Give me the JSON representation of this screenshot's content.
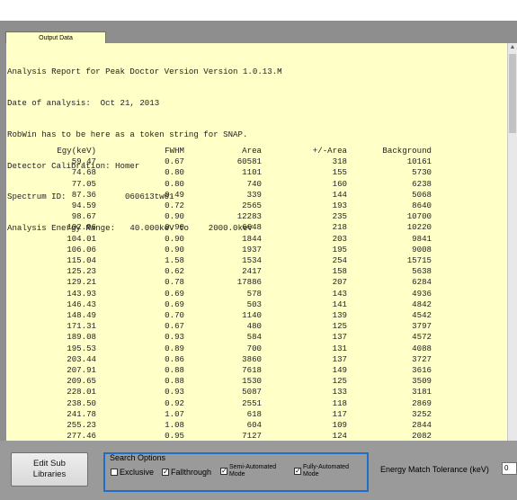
{
  "output_tab": {
    "label": "Output Data"
  },
  "report": {
    "lines": [
      "Analysis Report for Peak Doctor Version Version 1.0.13.M",
      "Date of analysis:  Oct 21, 2013",
      "RobWin has to be here as a token string for SNAP.",
      "Detector Calibration: Homer",
      "Spectrum ID:            060613tw01",
      "Analysis Energy Range:   40.000keV to    2000.0keV"
    ]
  },
  "peak_table": {
    "headers": [
      "Egy(keV)",
      "FWHM",
      "Area",
      "+/-Area",
      "Background"
    ],
    "rows": [
      [
        "59.47",
        "0.67",
        "60581",
        "318",
        "10161"
      ],
      [
        "74.68",
        "0.80",
        "1101",
        "155",
        "5730"
      ],
      [
        "77.05",
        "0.80",
        "740",
        "160",
        "6238"
      ],
      [
        "87.36",
        "0.49",
        "339",
        "144",
        "5068"
      ],
      [
        "94.59",
        "0.72",
        "2565",
        "193",
        "8640"
      ],
      [
        "98.67",
        "0.90",
        "12283",
        "235",
        "10700"
      ],
      [
        "102.96",
        "0.90",
        "6648",
        "218",
        "10220"
      ],
      [
        "104.01",
        "0.90",
        "1844",
        "203",
        "9841"
      ],
      [
        "106.06",
        "0.90",
        "1937",
        "195",
        "9008"
      ],
      [
        "115.04",
        "1.58",
        "1534",
        "254",
        "15715"
      ],
      [
        "125.23",
        "0.62",
        "2417",
        "158",
        "5638"
      ],
      [
        "129.21",
        "0.78",
        "17886",
        "207",
        "6284"
      ],
      [
        "143.93",
        "0.69",
        "578",
        "143",
        "4936"
      ],
      [
        "146.43",
        "0.69",
        "503",
        "141",
        "4842"
      ],
      [
        "148.49",
        "0.70",
        "1140",
        "139",
        "4542"
      ],
      [
        "171.31",
        "0.67",
        "480",
        "125",
        "3797"
      ],
      [
        "189.08",
        "0.93",
        "584",
        "137",
        "4572"
      ],
      [
        "195.53",
        "0.89",
        "700",
        "131",
        "4088"
      ],
      [
        "203.44",
        "0.86",
        "3860",
        "137",
        "3727"
      ],
      [
        "207.91",
        "0.88",
        "7618",
        "149",
        "3616"
      ],
      [
        "209.65",
        "0.88",
        "1530",
        "125",
        "3509"
      ],
      [
        "228.01",
        "0.93",
        "5087",
        "133",
        "3181"
      ],
      [
        "238.50",
        "0.92",
        "2551",
        "118",
        "2869"
      ],
      [
        "241.78",
        "1.07",
        "618",
        "117",
        "3252"
      ],
      [
        "255.23",
        "1.08",
        "604",
        "109",
        "2844"
      ],
      [
        "277.46",
        "0.95",
        "7127",
        "124",
        "2082"
      ]
    ]
  },
  "bottom": {
    "edit_sub_libraries_label": "Edit Sub\nLibraries",
    "search_options_title": "Search Options",
    "options": [
      {
        "label": "Exclusive",
        "checked": false
      },
      {
        "label": "Fallthrough",
        "checked": true
      },
      {
        "label": "Semi-Automated\nMode",
        "checked": true
      },
      {
        "label": "Fully-Automated\nMode",
        "checked": true
      }
    ],
    "tolerance_label": "Energy Match Tolerance (keV)",
    "tolerance_value": "0"
  },
  "colors": {
    "report_background": "#ffffc8",
    "frame_gray": "#8e8e8e",
    "search_group_border": "#1f6fc8"
  }
}
